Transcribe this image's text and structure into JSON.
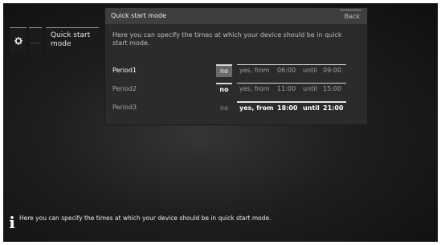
{
  "breadcrumb": {
    "gear_icon": "gear-icon",
    "dots_label": "...",
    "current_label": "Quick start mode"
  },
  "dialog": {
    "title": "Quick start mode",
    "back_label": "Back",
    "description": "Here you can specify the times at which your device should be in quick start mode.",
    "periods": [
      {
        "label": "Period1",
        "no": "no",
        "yes": "yes, from",
        "from": "06:00",
        "until": "until",
        "to": "09:00",
        "state": "no-selected"
      },
      {
        "label": "Period2",
        "no": "no",
        "yes": "yes, from",
        "from": "11:00",
        "until": "until",
        "to": "15:00",
        "state": "no-set"
      },
      {
        "label": "Period3",
        "no": "no",
        "yes": "yes, from",
        "from": "18:00",
        "until": "until",
        "to": "21:00",
        "state": "yes-set"
      }
    ]
  },
  "info": {
    "icon": "info-icon",
    "text": "Here you can specify the times at which your device should be in quick start mode."
  }
}
